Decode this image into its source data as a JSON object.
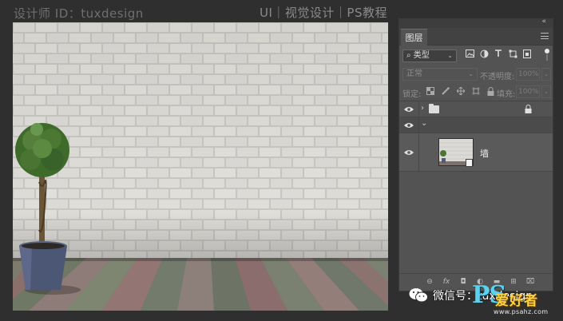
{
  "header": {
    "designer_credit": "设计师 ID：tuxdesign",
    "series_title": "UI｜视觉设计｜PS教程"
  },
  "layers_panel": {
    "collapse_glyph": "«",
    "tab_label": "图层",
    "filter": {
      "kind_label": "类型",
      "search_glyph": "⌕",
      "chevron": "⌄"
    },
    "filter_icons": [
      "image-filter-icon",
      "adjustment-filter-icon",
      "type-filter-icon",
      "shape-filter-icon",
      "smart-object-filter-icon"
    ],
    "blend_mode": "正常",
    "opacity_label": "不透明度:",
    "opacity_value": "100%",
    "lock_label": "锁定:",
    "fill_label": "填充:",
    "fill_value": "100%",
    "layers": [
      {
        "type": "group",
        "expander": "›",
        "locked": true,
        "visible": true
      },
      {
        "type": "group-open",
        "expander": "⌄",
        "visible": true
      },
      {
        "type": "smart-object",
        "name": "墙",
        "visible": true
      }
    ],
    "bottom_icons": [
      "link-layers-icon",
      "fx-icon",
      "add-mask-icon",
      "adjustment-layer-icon",
      "new-group-icon",
      "new-layer-icon",
      "delete-layer-icon"
    ],
    "bottom_icon_glyphs": [
      "⊖",
      "fx",
      "◘",
      "◐",
      "▬",
      "⊞",
      "⌧"
    ]
  },
  "watermark": {
    "wechat_text": "微信号：tuxdesign",
    "site_logo": "PS",
    "site_name": "爱好者",
    "site_url": "www.psahz.com"
  },
  "colors": {
    "app_background": "#2f2f2f",
    "panel_background": "#535353",
    "logo_cyan": "#5bd1f0",
    "logo_yellow": "#ffd23c"
  }
}
